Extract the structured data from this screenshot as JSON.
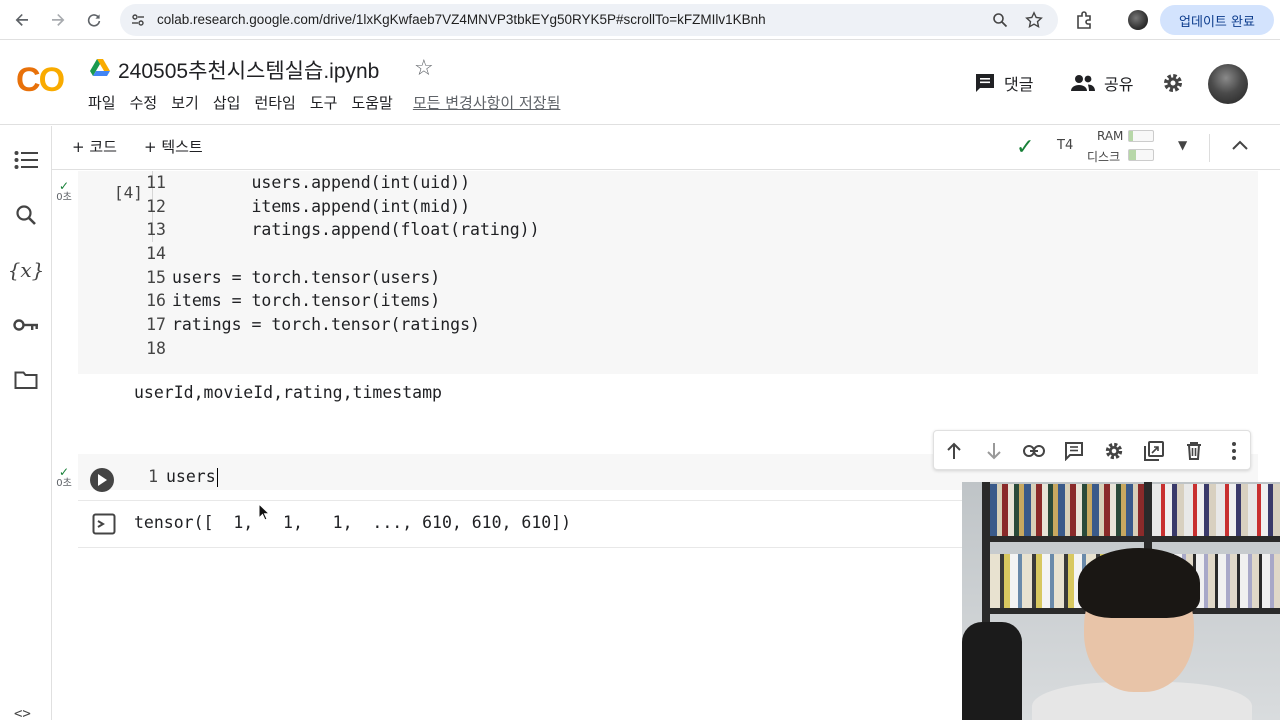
{
  "browser": {
    "url": "colab.research.google.com/drive/1lxKgKwfaeb7VZ4MNVP3tbkEYg50RYK5P#scrollTo=kFZMIlv1KBnh",
    "update_label": "업데이트 완료"
  },
  "header": {
    "title": "240505추천시스템실습.ipynb",
    "menu": [
      "파일",
      "수정",
      "보기",
      "삽입",
      "런타임",
      "도구",
      "도움말"
    ],
    "saved_status": "모든 변경사항이 저장됨",
    "comments_label": "댓글",
    "share_label": "공유"
  },
  "toolbar": {
    "add_code_label": "+ 코드",
    "add_text_label": "+ 텍스트",
    "runtime_type": "T4",
    "ram_label": "RAM",
    "disk_label": "디스크"
  },
  "cell1": {
    "status_time": "0초",
    "exec_count": "[4]",
    "lines": [
      {
        "n": "11",
        "code": "        users.append(int(uid))"
      },
      {
        "n": "12",
        "code": "        items.append(int(mid))"
      },
      {
        "n": "13",
        "code": "        ratings.append(float(rating))"
      },
      {
        "n": "14",
        "code": ""
      },
      {
        "n": "15",
        "code": "users = torch.tensor(users)"
      },
      {
        "n": "16",
        "code": "items = torch.tensor(items)"
      },
      {
        "n": "17",
        "code": "ratings = torch.tensor(ratings)"
      },
      {
        "n": "18",
        "code": ""
      }
    ],
    "output": "userId,movieId,rating,timestamp"
  },
  "cell2": {
    "status_time": "0초",
    "line_number": "1",
    "code": "users",
    "output": "tensor([  1,   1,   1,  ..., 610, 610, 610])"
  },
  "colors": {
    "accent_orange": "#e8710a",
    "accent_yellow": "#f9ab00",
    "success_green": "#188038",
    "cell_bg": "#f7f7f7"
  }
}
